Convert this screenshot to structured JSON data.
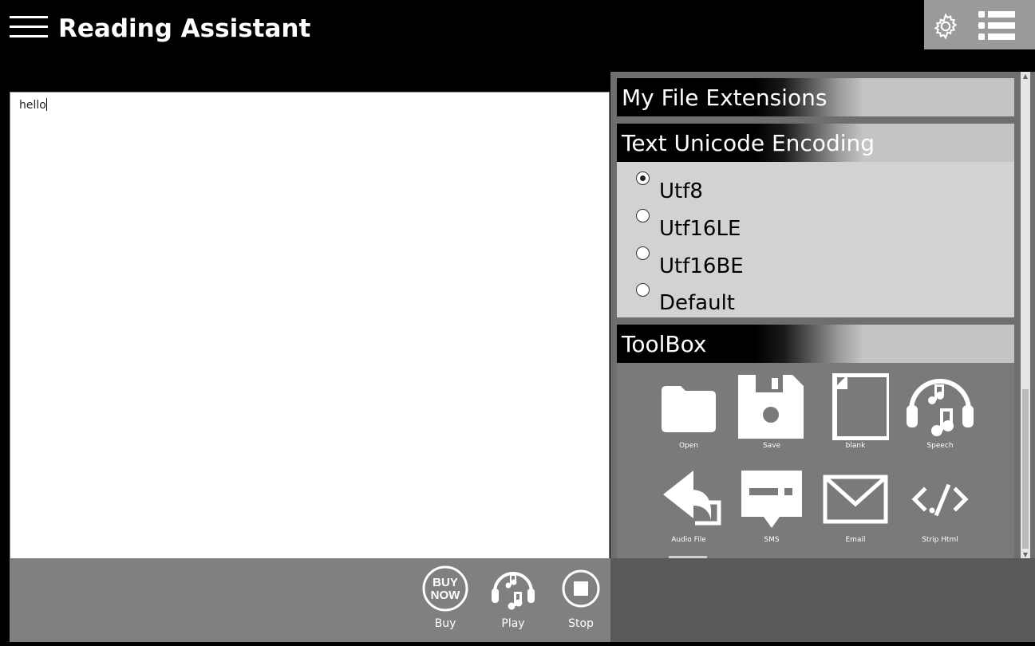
{
  "app": {
    "title": "Reading Assistant"
  },
  "editor": {
    "text": "hello"
  },
  "sections": {
    "file_extensions": {
      "title": "My File Extensions"
    },
    "encoding": {
      "title": "Text Unicode Encoding",
      "options": [
        {
          "label": "Utf8",
          "checked": true
        },
        {
          "label": "Utf16LE",
          "checked": false
        },
        {
          "label": "Utf16BE",
          "checked": false
        },
        {
          "label": "Default",
          "checked": false
        }
      ]
    },
    "toolbox": {
      "title": "ToolBox",
      "tools": [
        {
          "label": "Open",
          "icon": "folder-icon"
        },
        {
          "label": "Save",
          "icon": "floppy-icon"
        },
        {
          "label": "blank",
          "icon": "blank-page-icon"
        },
        {
          "label": "Speech",
          "icon": "headphones-music-icon"
        },
        {
          "label": "Audio File",
          "icon": "audio-file-icon"
        },
        {
          "label": "SMS",
          "icon": "sms-icon"
        },
        {
          "label": "Email",
          "icon": "email-icon"
        },
        {
          "label": "Strip Html",
          "icon": "code-icon"
        }
      ]
    }
  },
  "bottom_bar": {
    "buy": {
      "label": "Buy",
      "badge_line1": "BUY",
      "badge_line2": "NOW"
    },
    "play": {
      "label": "Play"
    },
    "stop": {
      "label": "Stop"
    }
  },
  "colors": {
    "accent": "#ffffff",
    "panel": "#d2d2d2",
    "toolbox": "#7a7a7a"
  }
}
